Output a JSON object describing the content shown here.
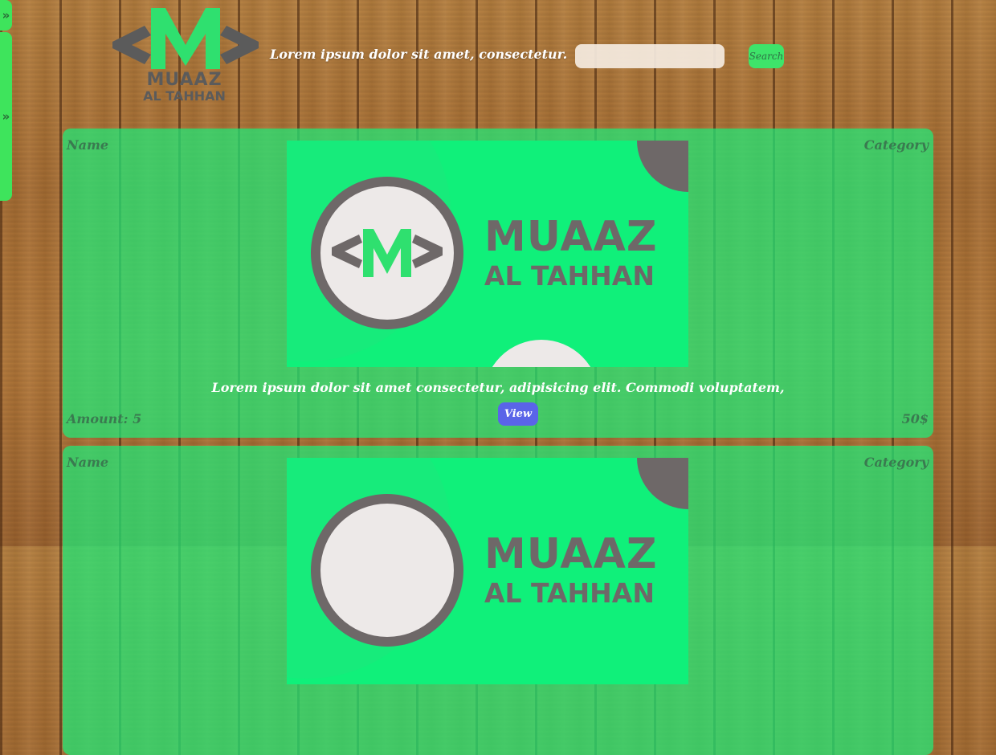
{
  "sidebar": {
    "toggle_top_label": "»",
    "toggle_side_label": "»"
  },
  "header": {
    "logo_line1": "MUAAZ",
    "logo_line2": "AL TAHHAN",
    "tagline": "Lorem ipsum dolor sit amet, consectetur.",
    "search": {
      "placeholder": "",
      "value": "",
      "button_label": "Search"
    }
  },
  "products": [
    {
      "name_label": "Name",
      "category_label": "Category",
      "image_logo_line1": "MUAAZ",
      "image_logo_line2": "AL TAHHAN",
      "description": "Lorem ipsum dolor sit amet consectetur, adipisicing elit. Commodi voluptatem,",
      "amount": "Amount: 5",
      "price": "50$",
      "view_label": "View"
    },
    {
      "name_label": "Name",
      "category_label": "Category",
      "image_logo_line1": "MUAAZ",
      "image_logo_line2": "AL TAHHAN",
      "description": "",
      "amount": "",
      "price": "",
      "view_label": ""
    }
  ],
  "colors": {
    "accent_green": "#3ee45c",
    "card_green": "#1fec78",
    "view_button": "#5a64e8",
    "logo_gray": "#5b5b5b"
  },
  "icons": [
    "double-chevron-right-icon",
    "logo-m-icon"
  ]
}
